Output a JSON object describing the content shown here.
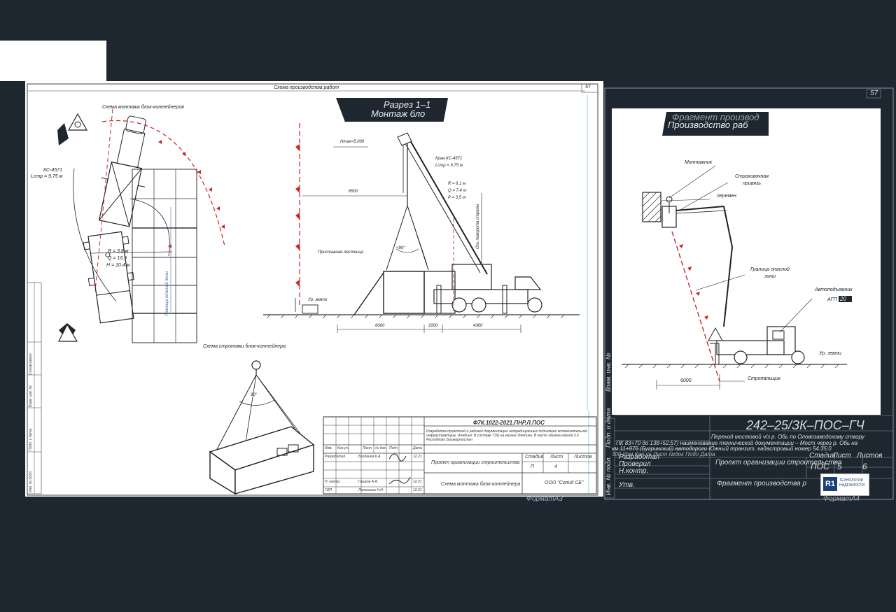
{
  "sheet_a3": {
    "header_title": "Схема производства работ",
    "page_number": "57",
    "banner": {
      "line1": "Разрез 1–1",
      "line2": "Монтаж бло"
    },
    "plan_title": "Схема монтажа блок-контейнеров",
    "sling_title": "Схема строповки блок-контейнера",
    "plan_labels": {
      "crane": "КС-4571",
      "boom": "Lстр.= 9.75 м",
      "r": "R = 3.8 м",
      "q": "Q = 16.9",
      "h": "H = 10.4 м",
      "zone": "Граница опасной зоны"
    },
    "section_labels": {
      "hmax": "Hmax=5.000",
      "crane": "Кран КС-4571",
      "boom": "Lстр = 9.75 м",
      "r": "R = 6.1 м",
      "q": "Q = 7.4 т",
      "p": "P = 3.5 т",
      "dim_top": "6500",
      "stairs": "Приставная лестница",
      "ground": "Ур. земли",
      "sling_angle": "<90°",
      "boom_axis": "Ось поворота стрелы",
      "dim_a": "6000",
      "dim_b": "2000",
      "dim_c": "4300"
    },
    "sling_angle": "90°",
    "title_block": {
      "code": "Ф7К.1022-2021.ПНР.Л.ПОС",
      "desc": "Разработка проектной и рабочей документации нетрадиционных подъемной вспомогательной инфраструктуры. Алабино. В составе ТЭЦ на укране Энетика. В части обьёма города 5.6 Республики Башкортостан",
      "project": "Проект организации строительства",
      "sheet_name": "Схема монтажа блок-контейнера",
      "company": "ООО \"Солид СБ\"",
      "stage_hdr": "Стадия",
      "sheet_hdr": "Лист",
      "sheets_hdr": "Листов",
      "stage": "П",
      "sheet": "4",
      "cols": [
        "Изм.",
        "Кол.уч.",
        "Лист",
        "№ док.",
        "Подп.",
        "Дата"
      ],
      "rows": [
        {
          "role": "Разработал",
          "name": "Богданов К.А.",
          "date": "12.21"
        },
        {
          "role": "Н. контр.",
          "name": "Гашков А.А.",
          "date": "12.21"
        },
        {
          "role": "ГИП",
          "name": "Латыгина Н.Н.",
          "date": "12.21"
        }
      ]
    },
    "side_stamps": [
      "Согласовано",
      "Взам. инв. №",
      "Подп. и дата",
      "Инв. № подл."
    ],
    "format": "ФорматА3"
  },
  "sheet_a4": {
    "page_number": "57",
    "banner": {
      "line1": "Фрагмент производ",
      "line2": "Производство раб"
    },
    "labels": {
      "installer": "Монтажник",
      "harness": "Страховочная привязь",
      "beam": "перемен",
      "danger": "Граница опасной зоны",
      "aerial": "Автоподъемник",
      "agp": "АГП",
      "agp_num": "20",
      "ground": "Ур. земли",
      "slinger": "Стропальщик",
      "dim": "6000"
    },
    "title_block": {
      "code": "242–25/ЗК–ПОС–ГЧ",
      "desc_line1": "Переход мостовой ч/з р. Обь по Оловозаводскому створу",
      "desc_line2": "ПК 83+70 до 138+52.57) наименование технической документации – Мост через р. Обь на",
      "desc_line3": "км 11+976 (Бугринский) автодороги Южный транзит, кадастровый номер 54:35:0",
      "desc_line4": "300 Изм.Кол.уч Лист №док Подп Дата",
      "dev": "Разработал",
      "checked": "Проверил",
      "nkontr": "Н.контр.",
      "utv": "Утв.",
      "stage_hdr": "Стадия",
      "sheet_hdr": "Лист",
      "sheets_hdr": "Листов",
      "stage": "ПОС",
      "sheet": "5",
      "sheets": "6",
      "project": "Проект организации строительства",
      "sheet_name": "Фрагмент производства р",
      "logo_mark": "R1",
      "logo_text": "ТЕХНОЛОГИИ НАДЕЖНОСТИ"
    },
    "side_stamps": [
      "Инв. № подл.",
      "Подп. и дата",
      "Взам. инв. №"
    ],
    "format": "ФорматА4"
  }
}
